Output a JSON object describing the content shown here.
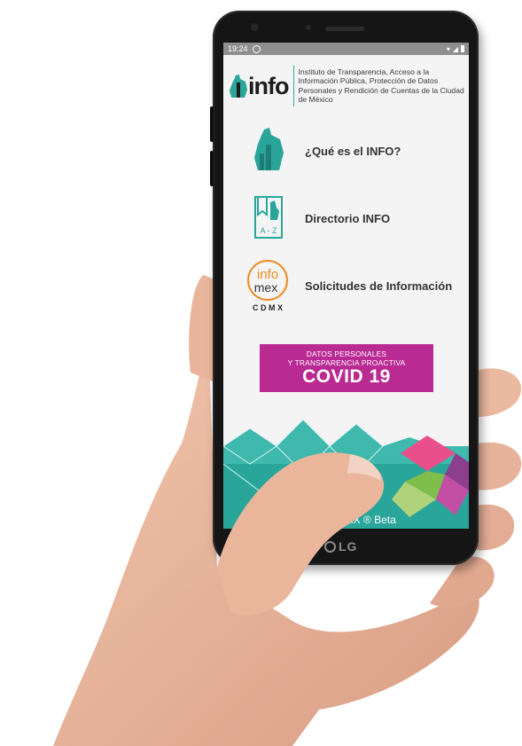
{
  "status_bar": {
    "time": "19:24",
    "left_icon": "whatsapp-icon",
    "right_icons": [
      "wifi-icon",
      "signal-icon",
      "battery-icon"
    ]
  },
  "header": {
    "logo_text": "info",
    "institution": "Instituto de Transparencia, Acceso a la Información Pública, Protección de Datos Personales y Rendición de Cuentas de la Ciudad de México"
  },
  "menu": [
    {
      "label": "¿Qué es el INFO?",
      "icon": "cdmx-map-icon"
    },
    {
      "label": "Directorio INFO",
      "icon": "directory-az-icon"
    },
    {
      "label": "Solicitudes de Información",
      "icon": "infomex-logo-icon"
    }
  ],
  "infomex_logo": {
    "line1": "info",
    "line2": "mex",
    "line3": "C D M X"
  },
  "directory_icon_text": "A - Z",
  "covid_banner": {
    "line1": "DATOS PERSONALES",
    "line2": "Y TRANSPARENCIA PROACTIVA",
    "line3": "COVID 19"
  },
  "footer": {
    "text": "DMX ® Beta"
  },
  "device": {
    "brand": "LG"
  },
  "colors": {
    "teal": "#2aa59a",
    "magenta": "#b92a93",
    "orange": "#f08a24"
  }
}
